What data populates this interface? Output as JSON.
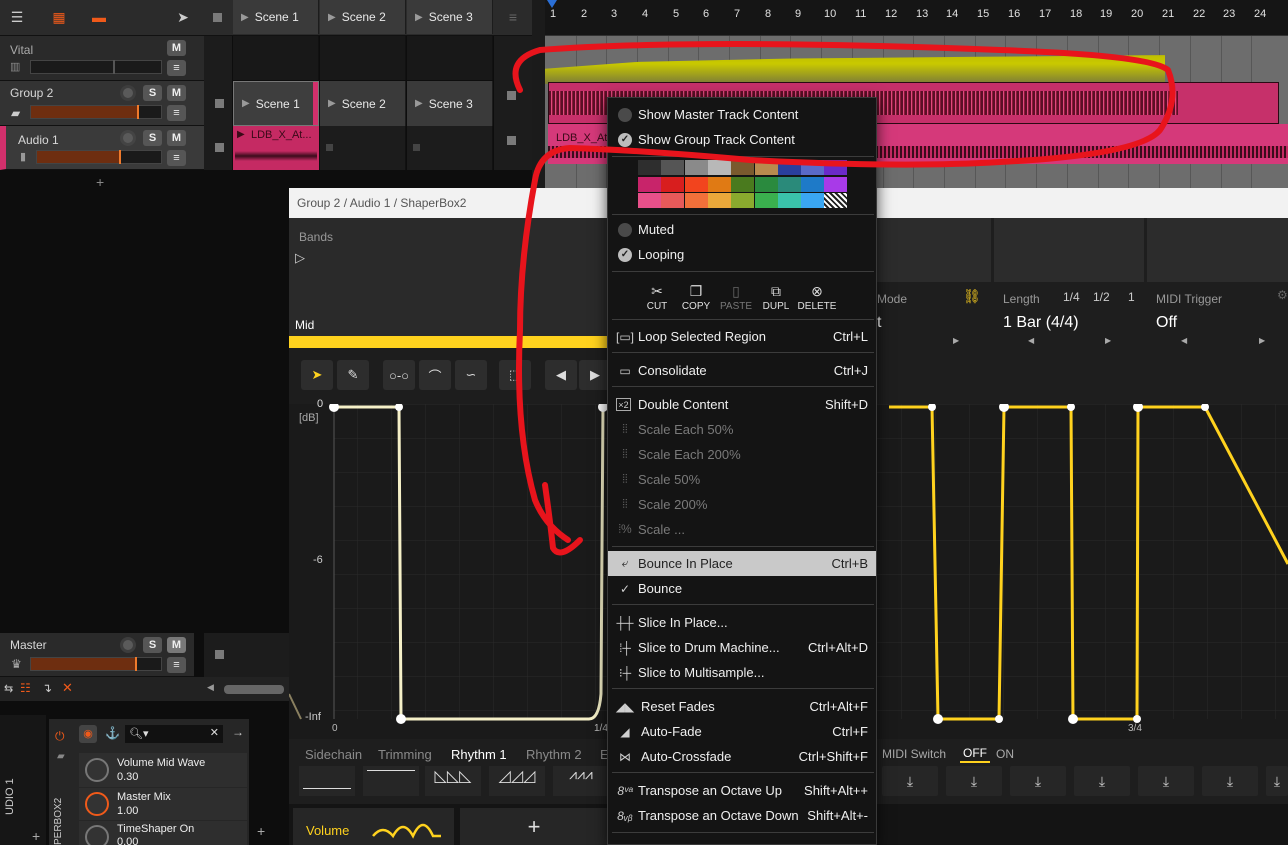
{
  "toolbar": {
    "scenes": [
      "Scene 1",
      "Scene 2",
      "Scene 3"
    ]
  },
  "ruler": {
    "bars": [
      "1",
      "2",
      "3",
      "4",
      "5",
      "6",
      "7",
      "8",
      "9",
      "10",
      "11",
      "12",
      "13",
      "14",
      "15",
      "16",
      "17",
      "18",
      "19",
      "20",
      "21",
      "22",
      "23",
      "24"
    ]
  },
  "tracks": {
    "vital": {
      "name": "Vital",
      "m": "M"
    },
    "group2": {
      "name": "Group 2",
      "s": "S",
      "m": "M",
      "scenes": [
        "Scene 1",
        "Scene 2",
        "Scene 3"
      ]
    },
    "audio1": {
      "name": "Audio 1",
      "s": "S",
      "m": "M",
      "clip": "LDB_X_At..."
    },
    "master": {
      "name": "Master",
      "s": "S",
      "m": "M"
    }
  },
  "arrange": {
    "clip_label": "LDB_X_At"
  },
  "device": {
    "breadcrumb": "Group 2 / Audio 1 / ShaperBox2",
    "bands_label": "Bands",
    "band_name": "Mid",
    "env_y_labels": [
      "0",
      "[dB]",
      "-6",
      "-Inf"
    ],
    "env_x_labels": [
      "0",
      "1/4",
      "3/4"
    ],
    "mode_label": "Mode",
    "mode_value": "t",
    "length_label": "Length",
    "length_value": "1 Bar (4/4)",
    "length_options": [
      "1/4",
      "1/2",
      "1"
    ],
    "midi_trigger_label": "MIDI Trigger",
    "midi_trigger_value": "Off",
    "subtabs": [
      "Sidechain",
      "Trimming",
      "Rhythm 1",
      "Rhythm 2",
      "E"
    ],
    "midi_switch_label": "MIDI Switch",
    "midi_off": "OFF",
    "midi_on": "ON",
    "volume_tab": "Volume",
    "add_tab": "+"
  },
  "inspector": {
    "params": [
      {
        "name": "Volume Mid Wave",
        "value": "0.30"
      },
      {
        "name": "Master Mix",
        "value": "1.00"
      },
      {
        "name": "TimeShaper On",
        "value": "0.00"
      }
    ],
    "vertical_label_1": "UDIO 1",
    "vertical_label_2": "PERBOX2"
  },
  "menu": {
    "show_master": "Show Master Track Content",
    "show_group": "Show Group Track Content",
    "colors": [
      [
        "#2e2e2e",
        "#555555",
        "#8a8a8a",
        "#b8b8b8",
        "#7a5a2e",
        "#b88a4e",
        "#2a3f9c",
        "#5a6ac8",
        "#6a2ac8"
      ],
      [
        "#c8246a",
        "#d81e1e",
        "#f2441e",
        "#e07a14",
        "#4a7a1e",
        "#2a8a3e",
        "#2a8a7a",
        "#1e7ac8",
        "#a83ae8"
      ],
      [
        "#e8508a",
        "#e85a5a",
        "#f2703a",
        "#eaa83a",
        "#8aaa2e",
        "#3ab04e",
        "#3ac2aa",
        "#3aa6f2",
        "striped"
      ]
    ],
    "muted": "Muted",
    "looping": "Looping",
    "clip_actions": [
      "CUT",
      "COPY",
      "PASTE",
      "DUPL",
      "DELETE"
    ],
    "items": {
      "loop_selected": {
        "label": "Loop Selected Region",
        "shortcut": "Ctrl+L"
      },
      "consolidate": {
        "label": "Consolidate",
        "shortcut": "Ctrl+J"
      },
      "double_content": {
        "label": "Double Content",
        "shortcut": "Shift+D"
      },
      "scale_each_50": {
        "label": "Scale Each 50%"
      },
      "scale_each_200": {
        "label": "Scale Each 200%"
      },
      "scale_50": {
        "label": "Scale 50%"
      },
      "scale_200": {
        "label": "Scale 200%"
      },
      "scale_dots": {
        "label": "Scale ..."
      },
      "bounce_in_place": {
        "label": "Bounce In Place",
        "shortcut": "Ctrl+B"
      },
      "bounce": {
        "label": "Bounce"
      },
      "slice_in_place": {
        "label": "Slice In Place..."
      },
      "slice_drum": {
        "label": "Slice to Drum Machine...",
        "shortcut": "Ctrl+Alt+D"
      },
      "slice_multi": {
        "label": "Slice to Multisample..."
      },
      "reset_fades": {
        "label": "Reset Fades",
        "shortcut": "Ctrl+Alt+F"
      },
      "auto_fade": {
        "label": "Auto-Fade",
        "shortcut": "Ctrl+F"
      },
      "auto_crossfade": {
        "label": "Auto-Crossfade",
        "shortcut": "Ctrl+Shift+F"
      },
      "transpose_up": {
        "label": "Transpose an Octave Up",
        "shortcut": "Shift+Alt++"
      },
      "transpose_down": {
        "label": "Transpose an Octave Down",
        "shortcut": "Shift+Alt+-"
      }
    }
  },
  "colors": {
    "accent_yellow": "#ffd21e",
    "clip_pink": "#d2306c",
    "annotation_red": "#e8141c",
    "highlight": "#c9c9c9"
  }
}
